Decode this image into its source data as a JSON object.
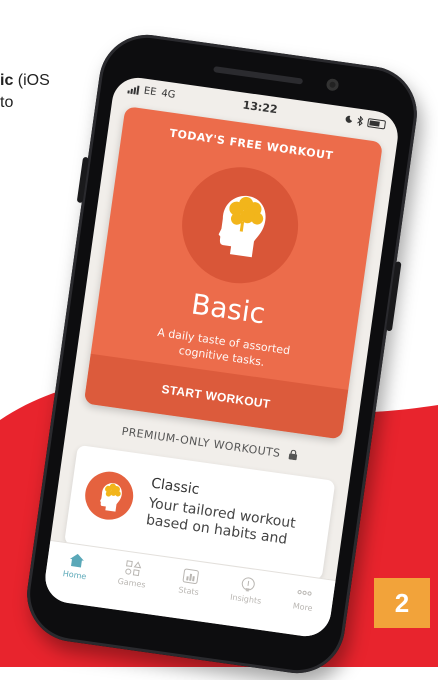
{
  "article": {
    "line1_bold": "ic",
    "line1_rest": " (iOS",
    "line2": "to"
  },
  "badge": {
    "number": "2"
  },
  "colors": {
    "accent_orange": "#ec6c4b",
    "badge_orange": "#f2a33a",
    "background_red": "#e8242d",
    "active_tab_teal": "#5aa8b8"
  },
  "status_bar": {
    "carrier": "EE",
    "network": "4G",
    "time": "13:22",
    "icons": [
      "signal-icon",
      "moon-icon",
      "bluetooth-icon",
      "battery-icon"
    ]
  },
  "workout_card": {
    "title": "TODAY'S FREE WORKOUT",
    "name": "Basic",
    "description": "A daily taste of assorted cognitive tasks.",
    "button_label": "START WORKOUT",
    "icon": "brain-head-icon"
  },
  "premium_section": {
    "title": "PREMIUM-ONLY WORKOUTS",
    "icon": "lock-icon"
  },
  "classic_card": {
    "name": "Classic",
    "description": "Your tailored workout based on habits and",
    "icon": "brain-head-icon"
  },
  "tab_bar": {
    "tabs": [
      {
        "label": "Home",
        "icon": "home-icon",
        "active": true
      },
      {
        "label": "Games",
        "icon": "games-icon",
        "active": false
      },
      {
        "label": "Stats",
        "icon": "stats-icon",
        "active": false
      },
      {
        "label": "Insights",
        "icon": "lightbulb-icon",
        "active": false
      },
      {
        "label": "More",
        "icon": "more-icon",
        "active": false
      }
    ]
  }
}
